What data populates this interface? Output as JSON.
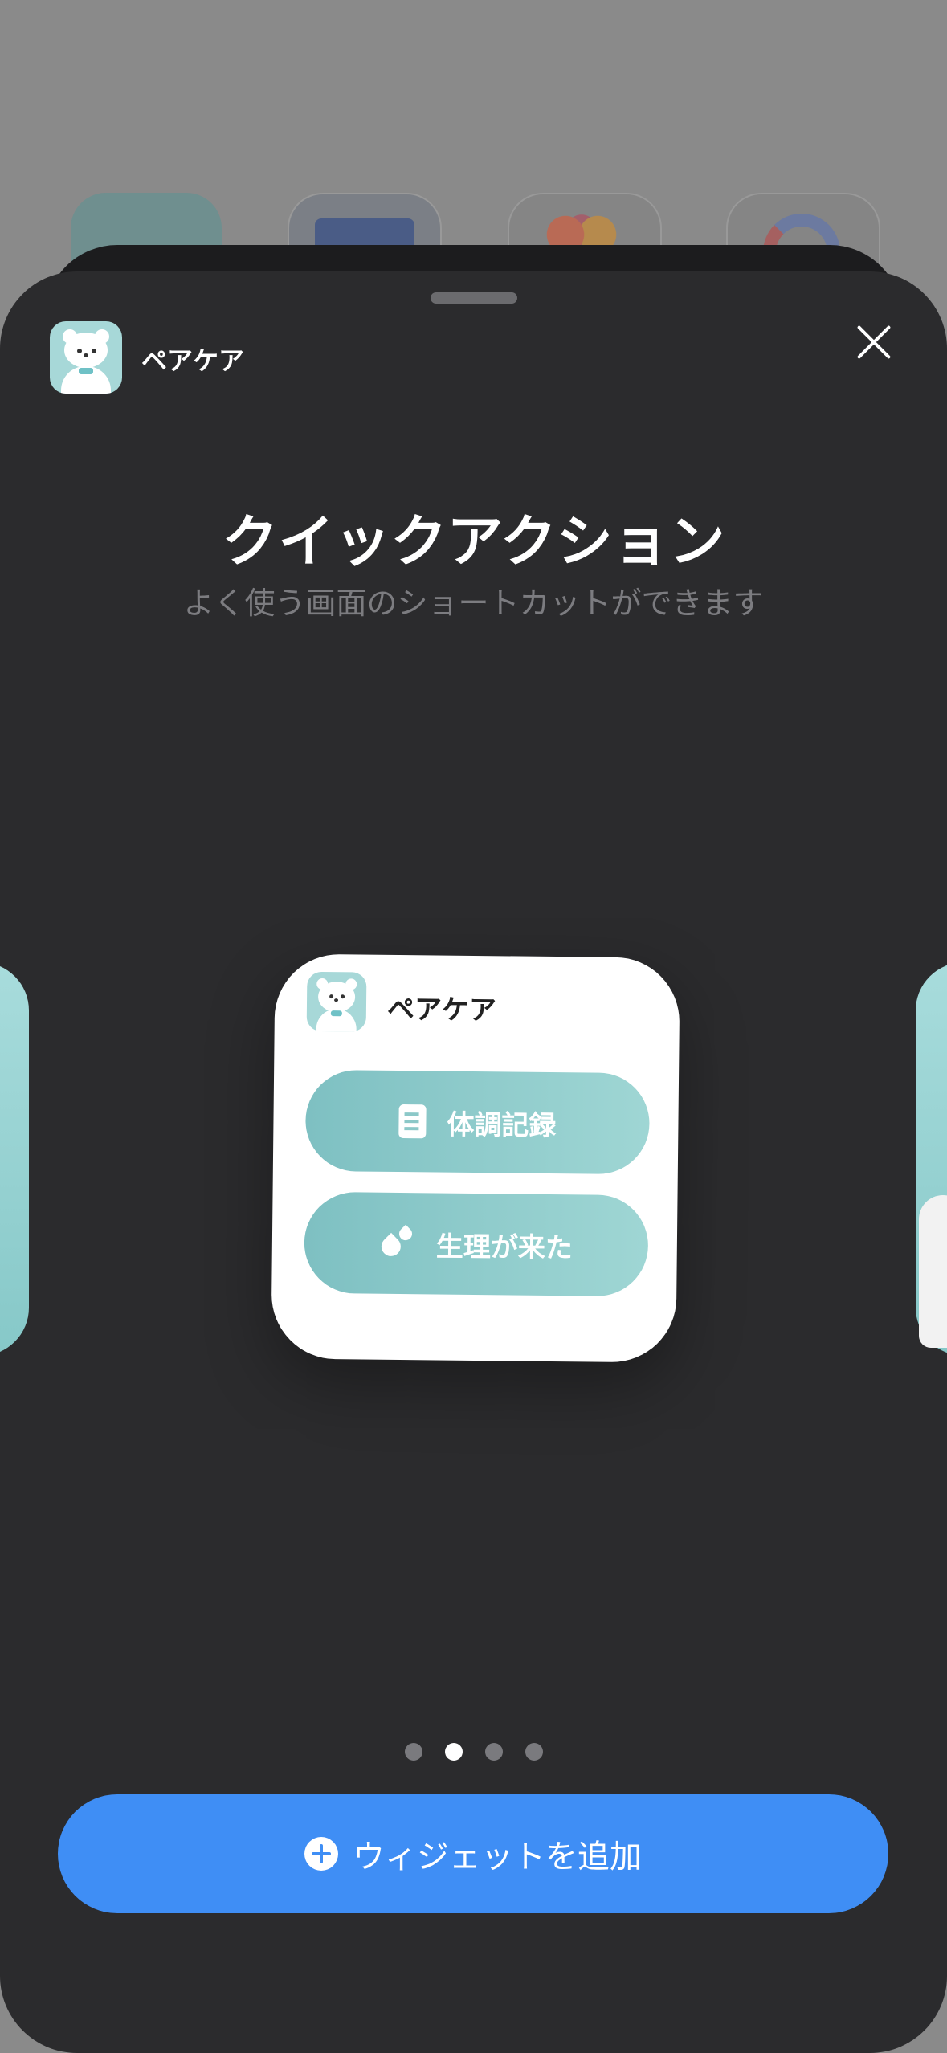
{
  "sheet": {
    "app_name": "ペアケア",
    "title": "クイックアクション",
    "subtitle": "よく使う画面のショートカットができます"
  },
  "widget": {
    "app_name": "ペアケア",
    "buttons": [
      {
        "label": "体調記録",
        "icon": "memo-icon"
      },
      {
        "label": "生理が来た",
        "icon": "drop-icon"
      }
    ]
  },
  "pagination": {
    "count": 4,
    "active_index": 1
  },
  "add_button": {
    "label": "ウィジェットを追加",
    "icon": "plus-circle-icon"
  },
  "colors": {
    "accent": "#3f8ef5",
    "widget_button": "#8ccbcb",
    "sheet_bg": "#2b2b2d"
  }
}
